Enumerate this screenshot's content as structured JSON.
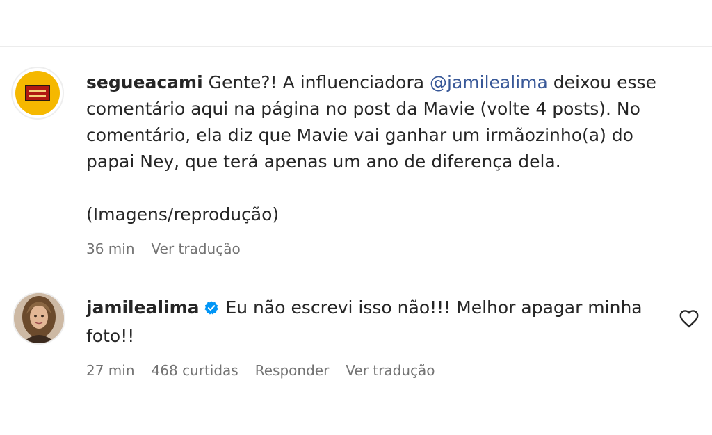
{
  "comments": [
    {
      "username": "segueacami",
      "text_before_mention": "Gente?! A influenciadora ",
      "mention": "@jamilealima",
      "text_after_mention": " deixou esse comentário aqui na página no post da Mavie (volte 4 posts). No comentário, ela diz que Mavie vai ganhar um irmãozinho(a) do papai Ney, que terá apenas um ano de diferença dela.",
      "note": "(Imagens/reprodução)",
      "time": "36 min",
      "translate": "Ver tradução"
    },
    {
      "username": "jamilealima",
      "verified": true,
      "text": "Eu não escrevi isso não!!! Melhor apagar minha foto!!",
      "time": "27 min",
      "likes": "468 curtidas",
      "reply": "Responder",
      "translate": "Ver tradução"
    }
  ],
  "icons": {
    "verified": "verified-badge-icon",
    "like": "heart-icon"
  },
  "colors": {
    "mention": "#385898",
    "verified": "#0095f6",
    "meta": "#737373"
  }
}
